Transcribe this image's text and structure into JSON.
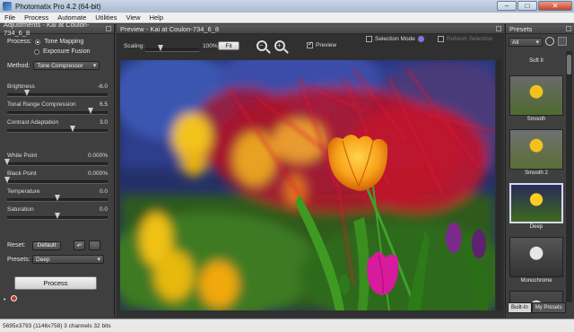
{
  "window": {
    "title": "Photomatix Pro 4.2 (64-bit)",
    "buttons": {
      "minimize": "–",
      "maximize": "□",
      "close": "✕"
    }
  },
  "menu": [
    "File",
    "Process",
    "Automate",
    "Utilities",
    "View",
    "Help"
  ],
  "adjustments": {
    "header": "Adjustments - Kai at Coulon-734_6_8",
    "process_label": "Process:",
    "process_options": [
      "Tone Mapping",
      "Exposure Fusion"
    ],
    "method_label": "Method:",
    "method_value": "Tone Compressor",
    "sliders": [
      {
        "label": "Brightness",
        "value": "-6.0",
        "level": 0.2
      },
      {
        "label": "Tonal Range Compression",
        "value": "6.5",
        "level": 0.83
      },
      {
        "label": "Contrast Adaptation",
        "value": "3.0",
        "level": 0.65
      },
      {
        "label": "White Point",
        "value": "0.000%",
        "level": 0.0
      },
      {
        "label": "Black Point",
        "value": "0.000%",
        "level": 0.0
      },
      {
        "label": "Temperature",
        "value": "0.0",
        "level": 0.5
      },
      {
        "label": "Saturation",
        "value": "0.0",
        "level": 0.5
      }
    ],
    "reset_label": "Reset:",
    "default_button": "Default",
    "presets_label": "Presets:",
    "presets_value": "Deep",
    "process_button": "Process"
  },
  "preview": {
    "header": "Preview - Kai at Coulon-734_6_8",
    "scaling_label": "Scaling:",
    "scaling_value": "100%",
    "scaling_level": 0.28,
    "fit_button": "Fit",
    "zoom_in": "+",
    "zoom_out": "−",
    "preview_checkbox": "Preview",
    "selection_mode": "Selection Mode",
    "refresh_label": "Refresh Selection"
  },
  "presets": {
    "header": "Presets",
    "filter_value": "All",
    "items": [
      "Soft II",
      "Smooth",
      "Smooth 2",
      "Deep",
      "Monochrome",
      ""
    ],
    "selected": "Deep",
    "tabs": [
      "Built-In",
      "My Presets"
    ]
  },
  "status": "5695x3793 (1146x758) 3 channels 32 bits",
  "colors": {
    "accent": "#d8d8ff",
    "panel": "#3f3f3f"
  }
}
